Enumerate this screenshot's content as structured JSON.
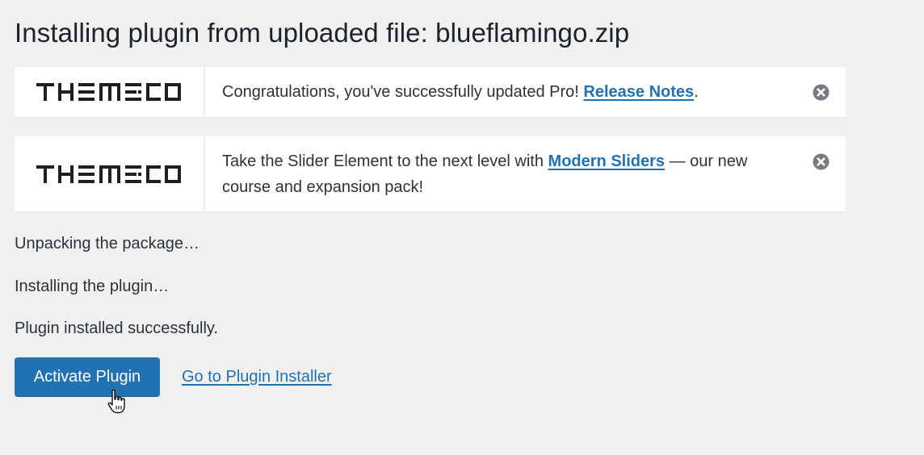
{
  "page": {
    "title": "Installing plugin from uploaded file: blueflamingo.zip"
  },
  "notices": [
    {
      "logo_text": "THEMECO",
      "text_before": "Congratulations, you've successfully updated Pro! ",
      "link_label": "Release Notes",
      "text_after": ".",
      "dismiss_icon": "close-circle-icon"
    },
    {
      "logo_text": "THEMECO",
      "text_before": "Take the Slider Element to the next level with ",
      "link_label": "Modern Sliders",
      "text_after": " — our new course and expansion pack!",
      "dismiss_icon": "close-circle-icon"
    }
  ],
  "log": [
    "Unpacking the package…",
    "Installing the plugin…",
    "Plugin installed successfully."
  ],
  "actions": {
    "activate_label": "Activate Plugin",
    "installer_link_label": "Go to Plugin Installer"
  },
  "colors": {
    "background": "#f0f0f1",
    "accent": "#2271b1",
    "notice_bg": "#ffffff"
  }
}
